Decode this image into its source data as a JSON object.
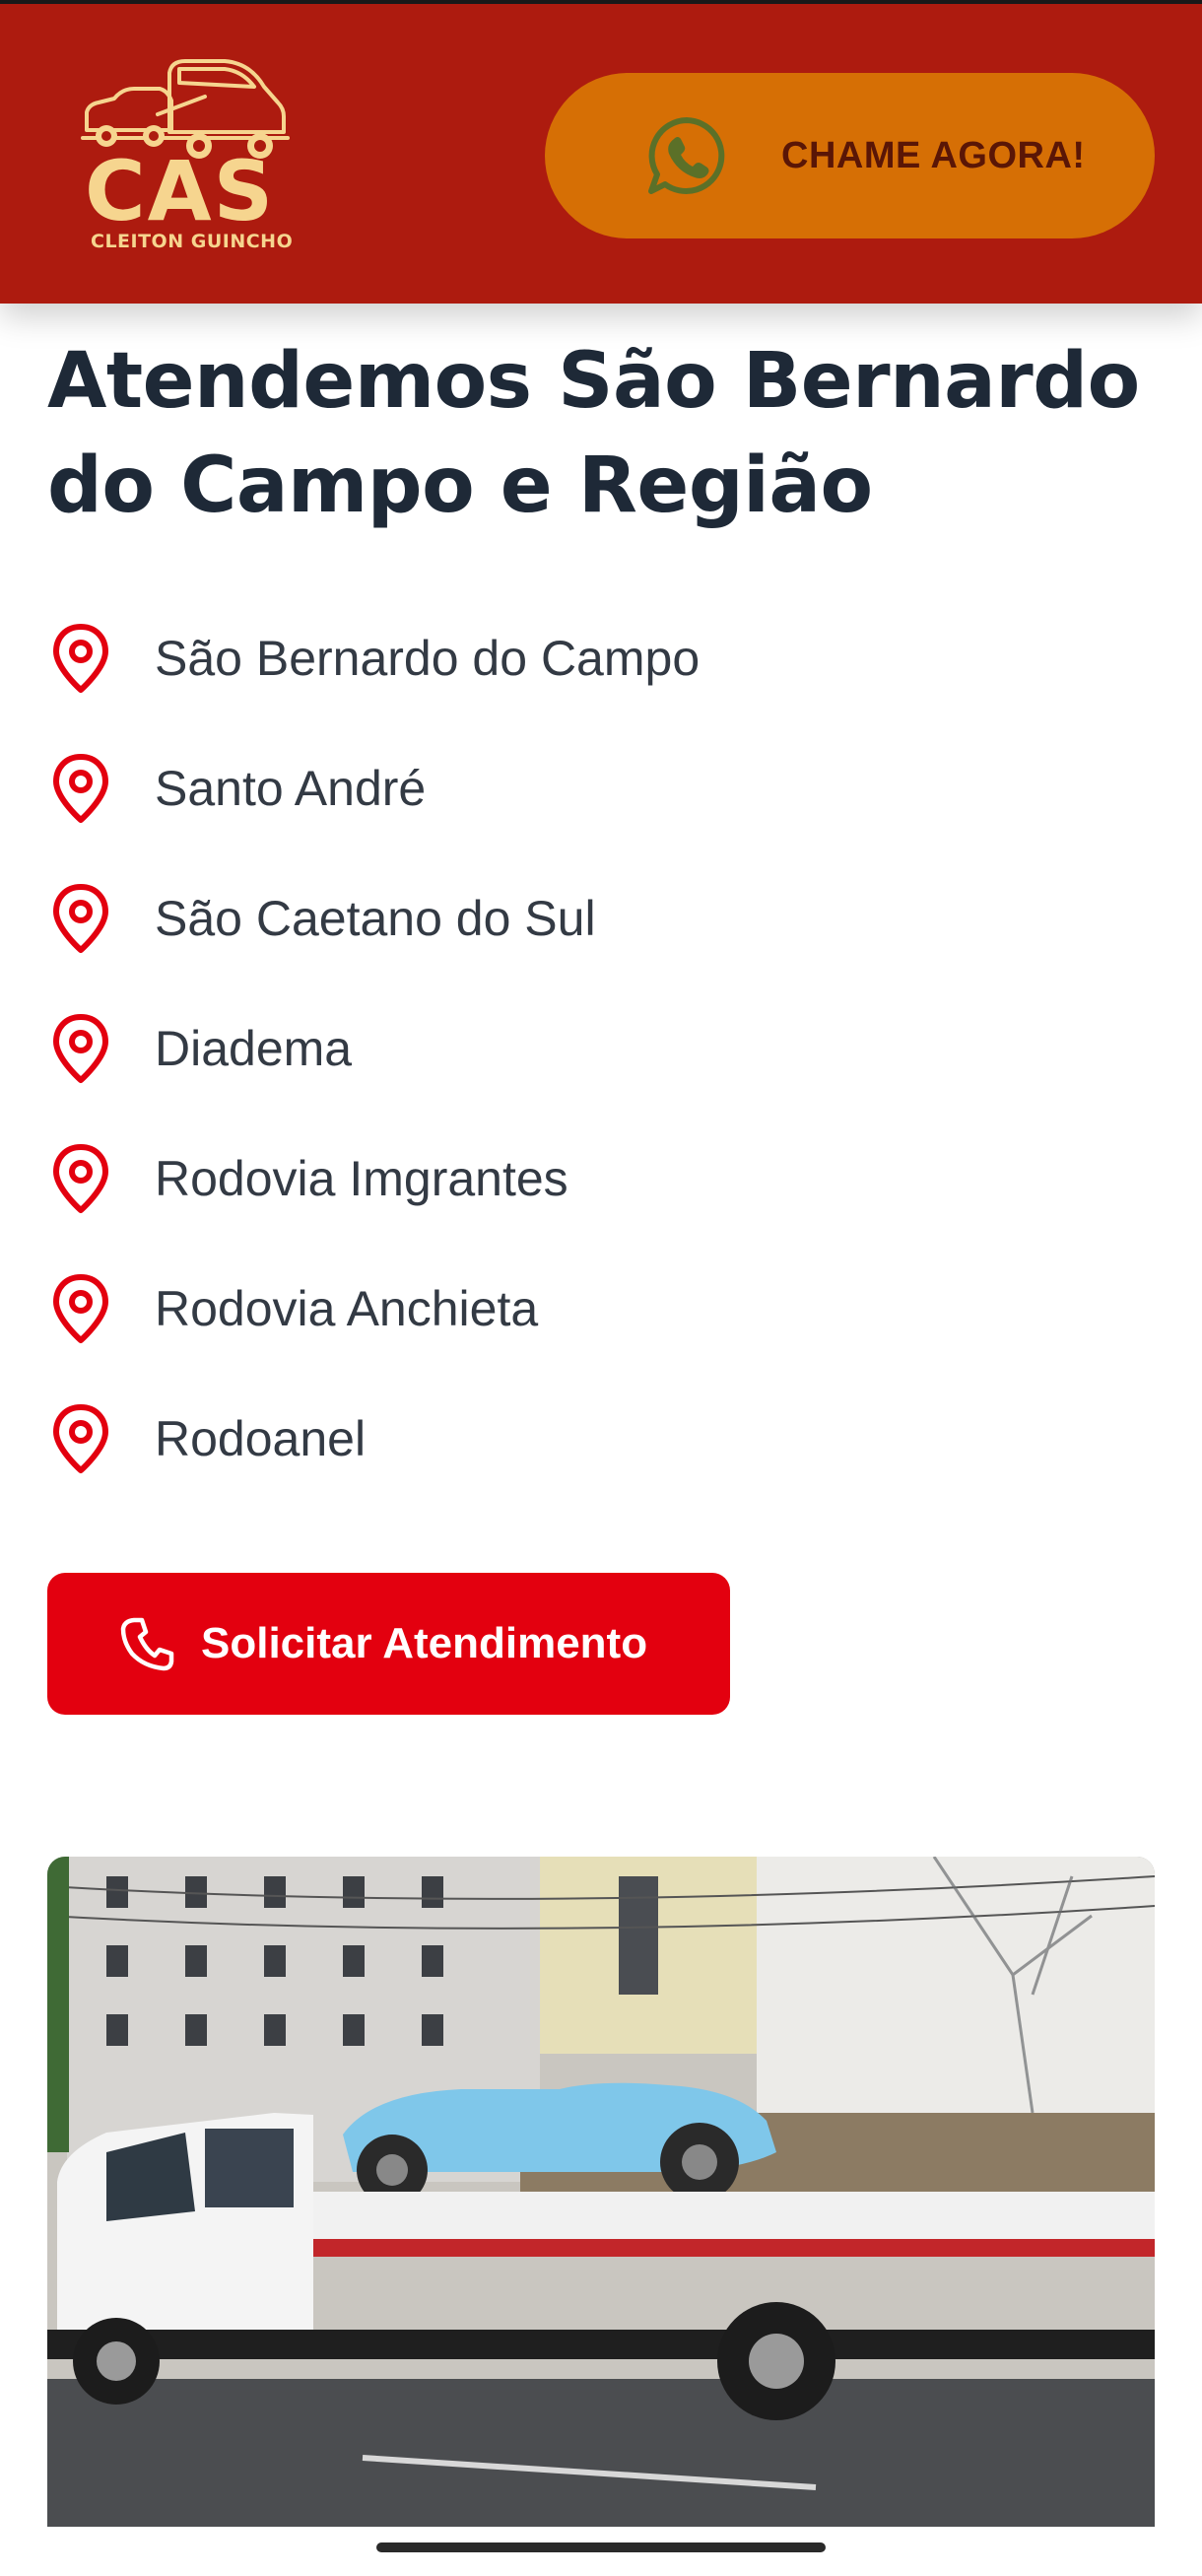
{
  "header": {
    "logo": {
      "brand": "CAS",
      "tagline": "CLEITON GUINCHO"
    },
    "cta": {
      "label": "CHAME AGORA!",
      "icon": "whatsapp-icon"
    },
    "colors": {
      "background": "#ad1b0f",
      "cta_background": "#d66f05",
      "logo": "#f6d58f"
    }
  },
  "main": {
    "title": "Atendemos São Bernardo do Campo e Região",
    "locations": [
      {
        "label": "São Bernardo do Campo",
        "icon": "map-pin-icon"
      },
      {
        "label": "Santo André",
        "icon": "map-pin-icon"
      },
      {
        "label": "São Caetano do Sul",
        "icon": "map-pin-icon"
      },
      {
        "label": "Diadema",
        "icon": "map-pin-icon"
      },
      {
        "label": "Rodovia Imgrantes",
        "icon": "map-pin-icon"
      },
      {
        "label": "Rodovia Anchieta",
        "icon": "map-pin-icon"
      },
      {
        "label": "Rodoanel",
        "icon": "map-pin-icon"
      }
    ],
    "request_button": {
      "label": "Solicitar Atendimento",
      "icon": "phone-icon"
    },
    "colors": {
      "pin": "#e3000f",
      "button": "#e3000f",
      "title": "#1e2937"
    }
  }
}
